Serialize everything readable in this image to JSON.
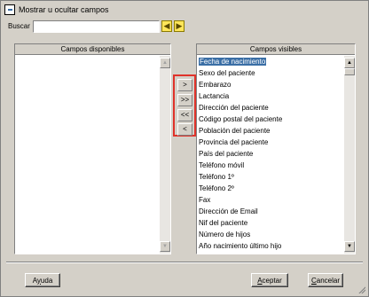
{
  "window": {
    "title": "Mostrar u ocultar campos"
  },
  "search": {
    "label": "Buscar",
    "value": ""
  },
  "available": {
    "header": "Campos disponibles",
    "items": []
  },
  "visible": {
    "header": "Campos visibles",
    "items": [
      "Fecha de nacimiento",
      "Sexo del paciente",
      "Embarazo",
      "Lactancia",
      "Dirección del paciente",
      "Código postal del paciente",
      "Población del paciente",
      "Provincia del paciente",
      "País del paciente",
      "Teléfono móvil",
      "Teléfono 1º",
      "Teléfono 2º",
      "Fax",
      "Dirección de Email",
      "Nif del paciente",
      "Número de hijos",
      "Año nacimiento último hijo"
    ],
    "selected_index": 0
  },
  "move_buttons": {
    "add_one": ">",
    "add_all": ">>",
    "remove_all": "<<",
    "remove_one": "<"
  },
  "buttons": {
    "help_pre": "A",
    "help_u": "y",
    "help_post": "uda",
    "accept_pre": "",
    "accept_u": "A",
    "accept_post": "ceptar",
    "cancel_pre": "",
    "cancel_u": "C",
    "cancel_post": "ancelar"
  },
  "colors": {
    "selection": "#3a6ea5",
    "highlight_frame": "#e0322a",
    "nav_arrows": "#ffe65a"
  }
}
